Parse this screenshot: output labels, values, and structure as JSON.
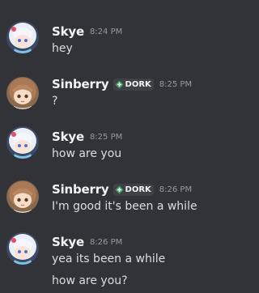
{
  "messages": [
    {
      "author": "Skye",
      "time": "8:24 PM",
      "lines": [
        "hey"
      ]
    },
    {
      "author": "Sinberry",
      "tag": "DORK",
      "time": "8:25 PM",
      "lines": [
        "?"
      ]
    },
    {
      "author": "Skye",
      "time": "8:25 PM",
      "lines": [
        "how are you"
      ]
    },
    {
      "author": "Sinberry",
      "tag": "DORK",
      "time": "8:26 PM",
      "lines": [
        "I'm good it's been a while"
      ]
    },
    {
      "author": "Skye",
      "time": "8:26 PM",
      "lines": [
        "yea its been a while",
        "how are you?"
      ]
    }
  ],
  "colors": {
    "background": "#313338",
    "username": "#f2f3f5",
    "message_text": "#dbdee1",
    "timestamp": "#949ba4",
    "tag_background": "#3f4147",
    "tag_icon": "#3ba55c"
  },
  "icons": {
    "skye_avatar": "anime-girl-white-hair-avatar",
    "sinberry_avatar": "anime-girl-brown-hair-avatar",
    "tag_icon": "diamond-plus-icon"
  }
}
